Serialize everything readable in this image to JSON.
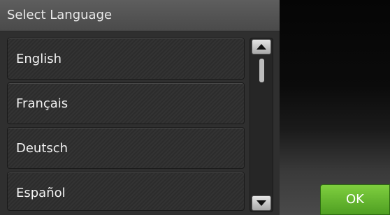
{
  "header": {
    "title": "Select Language"
  },
  "languages": [
    {
      "label": "English"
    },
    {
      "label": "Français"
    },
    {
      "label": "Deutsch"
    },
    {
      "label": "Español"
    }
  ],
  "scrollbar": {
    "up_icon": "triangle-up-icon",
    "down_icon": "triangle-down-icon"
  },
  "actions": {
    "ok_label": "OK"
  },
  "colors": {
    "ok_green": "#5fb12f",
    "panel_gray": "#3c3c3c"
  }
}
